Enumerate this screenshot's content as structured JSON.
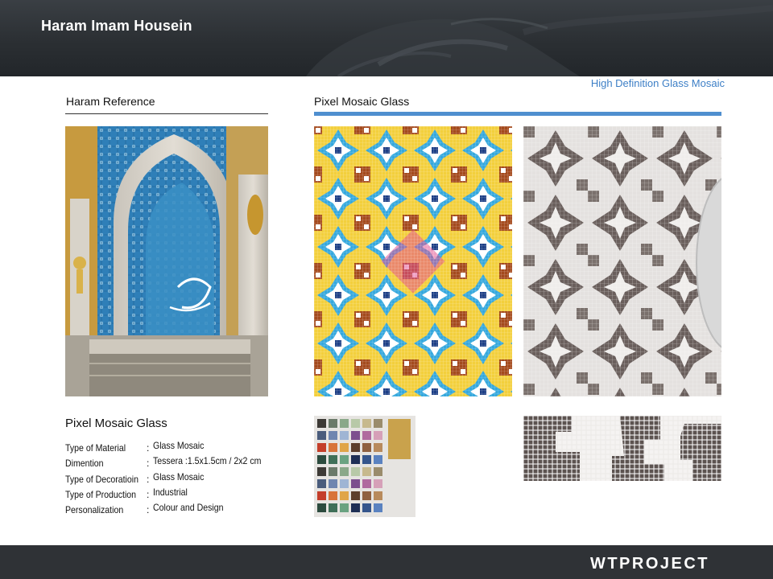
{
  "header": {
    "title": "Haram Imam Housein"
  },
  "tagline": "High Definition Glass Mosaic",
  "left_section": {
    "title": "Haram Reference"
  },
  "right_section": {
    "title": "Pixel Mosaic Glass"
  },
  "specs": {
    "title": "Pixel Mosaic Glass",
    "rows": [
      {
        "label": "Type of Material",
        "colon": ":",
        "value": "Glass Mosaic"
      },
      {
        "label": "Dimention",
        "colon": ":",
        "value": "Tessera :1.5x1.5cm / 2x2 cm"
      },
      {
        "label": "Type of Decoratioin",
        "colon": ":",
        "value": "Glass Mosaic"
      },
      {
        "label": "Type of Production",
        "colon": ":",
        "value": "Industrial"
      },
      {
        "label": "Personalization",
        "colon": ":",
        "value": "Colour and Design"
      }
    ]
  },
  "footer": {
    "logo_wt": "WT",
    "logo_project": "PROJECT"
  },
  "colors": {
    "accent_blue": "#4f8fcf",
    "tagline_blue": "#3d7fc6",
    "header_bg": "#2b2f33",
    "footer_bg": "#2f3236"
  }
}
